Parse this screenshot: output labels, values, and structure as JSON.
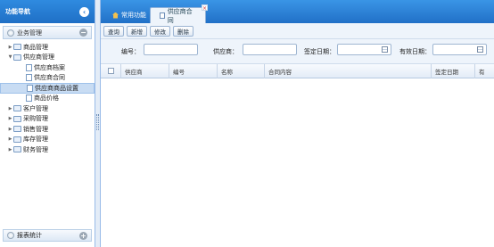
{
  "left": {
    "title": "功能导航",
    "collapse_icon": "chevron-left-circle-icon",
    "group_top": "业务管理",
    "group_bottom": "报表统计",
    "tree": [
      {
        "label": "商品管理",
        "type": "folder",
        "expanded": false
      },
      {
        "label": "供应商管理",
        "type": "folder",
        "expanded": true
      },
      {
        "label": "供应商档案",
        "type": "file"
      },
      {
        "label": "供应商合同",
        "type": "file"
      },
      {
        "label": "供应商商品设置",
        "type": "file",
        "selected": true
      },
      {
        "label": "商品价格",
        "type": "file"
      },
      {
        "label": "客户管理",
        "type": "folder",
        "expanded": false
      },
      {
        "label": "采购管理",
        "type": "folder",
        "expanded": false
      },
      {
        "label": "销售管理",
        "type": "folder",
        "expanded": false
      },
      {
        "label": "库存管理",
        "type": "folder",
        "expanded": false
      },
      {
        "label": "财务管理",
        "type": "folder",
        "expanded": false
      }
    ]
  },
  "tabs": {
    "home": "常用功能",
    "active": "供应商合同"
  },
  "toolbar": {
    "query": "查询",
    "add": "新增",
    "edit": "修改",
    "delete": "删除"
  },
  "form": {
    "code_label": "编号：",
    "supplier_label": "供应商：",
    "sign_date_label": "签定日期：",
    "valid_date_label": "有效日期："
  },
  "grid": {
    "columns": [
      "供应商",
      "编号",
      "名称",
      "合同内容",
      "签定日期",
      "有"
    ]
  },
  "colors": {
    "header_blue": "#2a78d0",
    "panel_bg": "#eef4fb",
    "selected_row": "#c8dcf3"
  }
}
